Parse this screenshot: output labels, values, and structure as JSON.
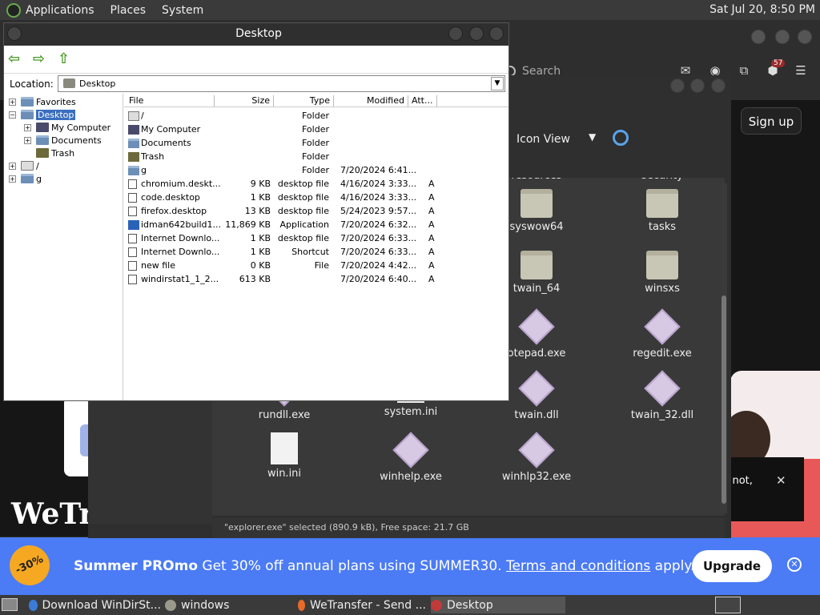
{
  "top_panel": {
    "menus": [
      "Applications",
      "Places",
      "System"
    ],
    "clock": "Sat Jul 20,  8:50 PM"
  },
  "browser": {
    "search_placeholder": "Search",
    "badge_count": "57",
    "signup": "Sign up",
    "logo": "WeTra",
    "toast_text": "r not,",
    "promo": {
      "tag": "-30%",
      "headline": "Summer PROmo",
      "body": " Get 30% off annual plans using SUMMER30. ",
      "link": "Terms and conditions",
      "tail": " apply.",
      "upgrade": "Upgrade"
    }
  },
  "file_manager": {
    "view_mode": "Icon View",
    "status": "\"explorer.exe\" selected (890.9 kB), Free space: 21.7 GB",
    "icons": [
      {
        "label": "resources",
        "type": "none"
      },
      {
        "label": "security",
        "type": "none"
      },
      {
        "label": "syswow64",
        "type": "folder"
      },
      {
        "label": "tasks",
        "type": "folder"
      },
      {
        "label": "twain_64",
        "type": "folder"
      },
      {
        "label": "winsxs",
        "type": "folder"
      },
      {
        "label": "otepad.exe",
        "type": "exe"
      },
      {
        "label": "regedit.exe",
        "type": "exe"
      },
      {
        "label": "rundll.exe",
        "type": "exe"
      },
      {
        "label": "system.ini",
        "type": "doc"
      },
      {
        "label": "twain.dll",
        "type": "exe"
      },
      {
        "label": "twain_32.dll",
        "type": "exe"
      },
      {
        "label": "win.ini",
        "type": "doc"
      },
      {
        "label": "winhelp.exe",
        "type": "exe"
      },
      {
        "label": "winhlp32.exe",
        "type": "exe"
      }
    ]
  },
  "desktop_window": {
    "title": "Desktop",
    "location_label": "Location:",
    "location_value": "Desktop",
    "tree": [
      {
        "label": "Favorites",
        "exp": "+",
        "icon": "folder",
        "indent": 0,
        "selected": false
      },
      {
        "label": "Desktop",
        "exp": "−",
        "icon": "folder",
        "indent": 0,
        "selected": true
      },
      {
        "label": "My Computer",
        "exp": "+",
        "icon": "computer",
        "indent": 1,
        "selected": false
      },
      {
        "label": "Documents",
        "exp": "+",
        "icon": "folder",
        "indent": 1,
        "selected": false
      },
      {
        "label": "Trash",
        "exp": "",
        "icon": "trash",
        "indent": 1,
        "selected": false
      },
      {
        "label": "/",
        "exp": "+",
        "icon": "drive",
        "indent": 0,
        "selected": false
      },
      {
        "label": "g",
        "exp": "+",
        "icon": "folder",
        "indent": 0,
        "selected": false
      }
    ],
    "columns": [
      "File",
      "Size",
      "Type",
      "Modified",
      "Att..."
    ],
    "rows": [
      {
        "name": "/",
        "size": "",
        "type": "Folder",
        "modified": "",
        "att": "",
        "icon": "drive"
      },
      {
        "name": "My Computer",
        "size": "",
        "type": "Folder",
        "modified": "",
        "att": "",
        "icon": "computer"
      },
      {
        "name": "Documents",
        "size": "",
        "type": "Folder",
        "modified": "",
        "att": "",
        "icon": "folder"
      },
      {
        "name": "Trash",
        "size": "",
        "type": "Folder",
        "modified": "",
        "att": "",
        "icon": "trash"
      },
      {
        "name": "g",
        "size": "",
        "type": "Folder",
        "modified": "7/20/2024 6:41...",
        "att": "",
        "icon": "folder"
      },
      {
        "name": "chromium.deskt...",
        "size": "9 KB",
        "type": "desktop file",
        "modified": "4/16/2024 3:33...",
        "att": "A",
        "icon": "file"
      },
      {
        "name": "code.desktop",
        "size": "1 KB",
        "type": "desktop file",
        "modified": "4/16/2024 3:33...",
        "att": "A",
        "icon": "file"
      },
      {
        "name": "firefox.desktop",
        "size": "13 KB",
        "type": "desktop file",
        "modified": "5/24/2023 9:57...",
        "att": "A",
        "icon": "file"
      },
      {
        "name": "idman642build1...",
        "size": "11,869 KB",
        "type": "Application",
        "modified": "7/20/2024 6:32...",
        "att": "A",
        "icon": "app"
      },
      {
        "name": "Internet Downlo...",
        "size": "1 KB",
        "type": "desktop file",
        "modified": "7/20/2024 6:33...",
        "att": "A",
        "icon": "file"
      },
      {
        "name": "Internet Downlo...",
        "size": "1 KB",
        "type": "Shortcut",
        "modified": "7/20/2024 6:33...",
        "att": "A",
        "icon": "file"
      },
      {
        "name": "new file",
        "size": "0 KB",
        "type": "File",
        "modified": "7/20/2024 4:42...",
        "att": "A",
        "icon": "file"
      },
      {
        "name": "windirstat1_1_2...",
        "size": "613 KB",
        "type": "",
        "modified": "7/20/2024 6:40...",
        "att": "A",
        "icon": "file"
      }
    ]
  },
  "taskbar": {
    "tasks": [
      {
        "label": "Download WinDirSt...",
        "color": "#3a7bd5",
        "active": false
      },
      {
        "label": "windows",
        "color": "#9a9a8a",
        "active": false
      },
      {
        "label": "WeTransfer - Send ...",
        "color": "#e86a2a",
        "active": false
      },
      {
        "label": "Desktop",
        "color": "#c23a3a",
        "active": true
      }
    ]
  }
}
